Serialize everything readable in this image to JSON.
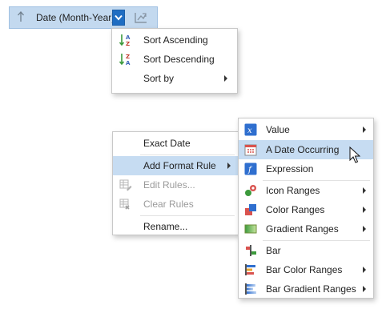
{
  "field": {
    "label": "Date (Month-Year)",
    "sort_icon": "sort-up-arrow-icon",
    "dropdown_icon": "chevron-down-icon",
    "extra_icon": "chart-options-icon"
  },
  "sort_menu": {
    "items": [
      {
        "label": "Sort Ascending",
        "icon": "sort-ascending-icon"
      },
      {
        "label": "Sort Descending",
        "icon": "sort-descending-icon"
      },
      {
        "label": "Sort by",
        "icon": ""
      }
    ]
  },
  "context_menu": {
    "items": [
      {
        "label": "Exact Date"
      },
      {
        "label": "Add Format Rule"
      },
      {
        "label": "Edit Rules...",
        "disabled": true,
        "icon": "edit-rules-icon"
      },
      {
        "label": "Clear Rules",
        "disabled": true,
        "icon": "clear-rules-icon"
      },
      {
        "label": "Rename..."
      }
    ]
  },
  "format_menu": {
    "items": [
      {
        "label": "Value",
        "icon": "value-icon"
      },
      {
        "label": "A Date Occurring",
        "icon": "calendar-icon"
      },
      {
        "label": "Expression",
        "icon": "expression-icon"
      },
      {
        "label": "Icon Ranges",
        "icon": "icon-ranges-icon"
      },
      {
        "label": "Color Ranges",
        "icon": "color-ranges-icon"
      },
      {
        "label": "Gradient Ranges",
        "icon": "gradient-ranges-icon"
      },
      {
        "label": "Bar",
        "icon": "bar-icon"
      },
      {
        "label": "Bar Color Ranges",
        "icon": "bar-color-ranges-icon"
      },
      {
        "label": "Bar Gradient Ranges",
        "icon": "bar-gradient-ranges-icon"
      }
    ]
  },
  "colors": {
    "highlight": "#c6dcf2",
    "field_bg": "#c3d9ef",
    "dropdown_accent": "#1f6dc2"
  }
}
